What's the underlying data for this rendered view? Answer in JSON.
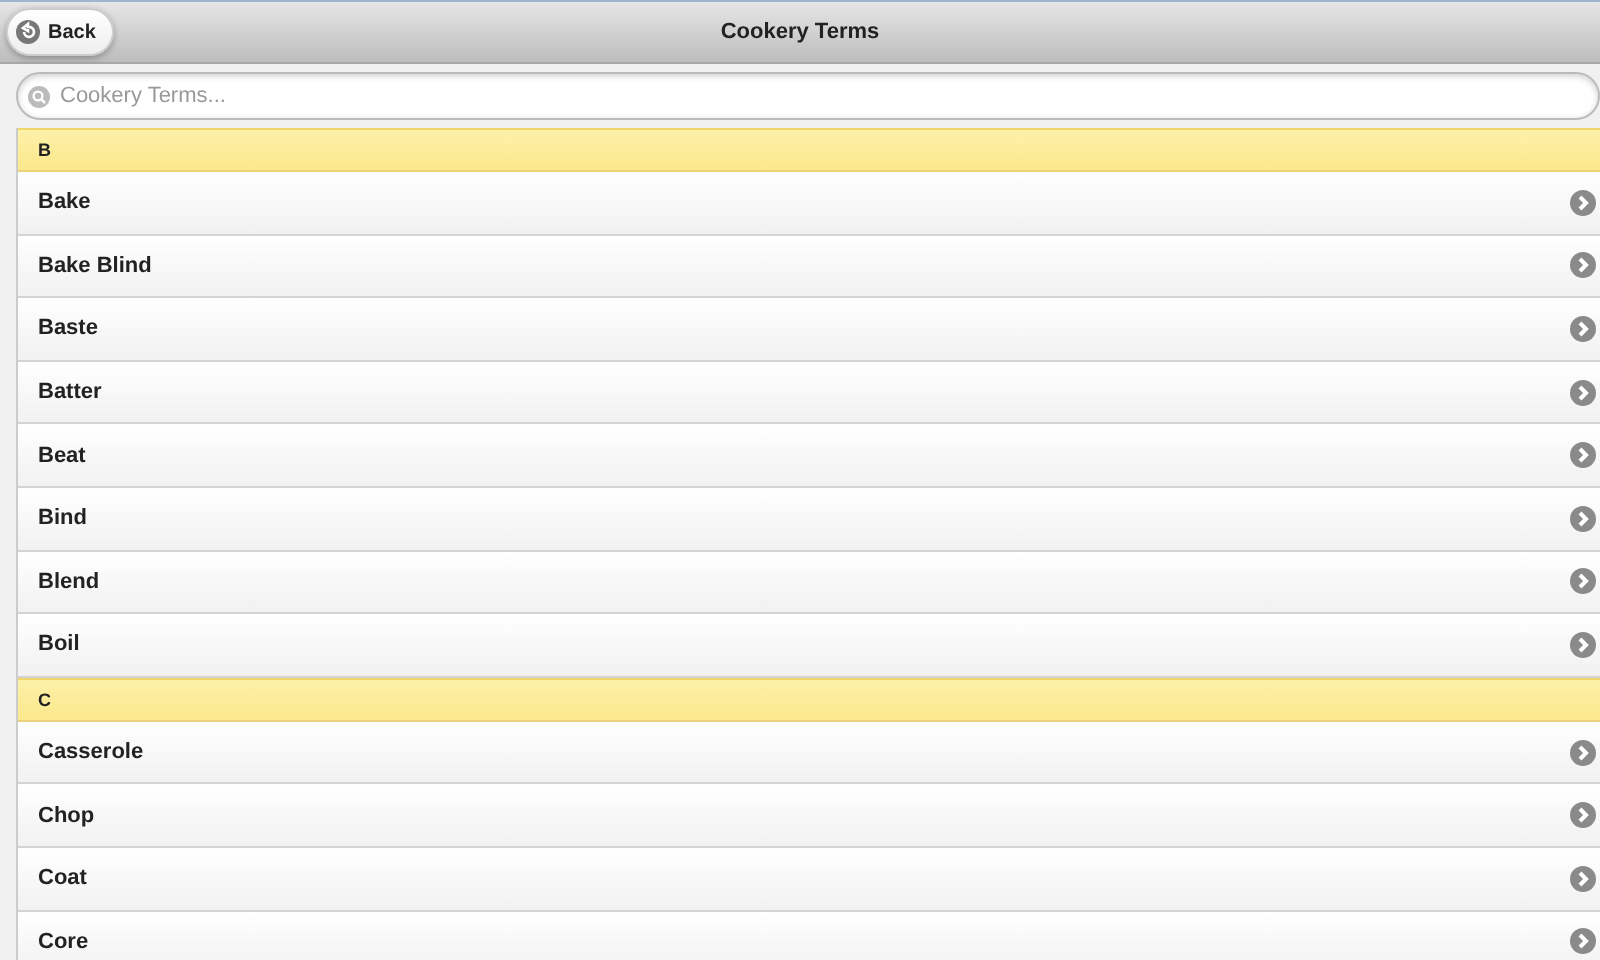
{
  "header": {
    "back_button": "Back",
    "title": "Cookery Terms"
  },
  "search": {
    "placeholder": "Cookery Terms..."
  },
  "sections": [
    {
      "letter": "B",
      "items": [
        "Bake",
        "Bake Blind",
        "Baste",
        "Batter",
        "Beat",
        "Bind",
        "Blend",
        "Boil"
      ]
    },
    {
      "letter": "C",
      "items": [
        "Casserole",
        "Chop",
        "Coat",
        "Core"
      ]
    }
  ]
}
